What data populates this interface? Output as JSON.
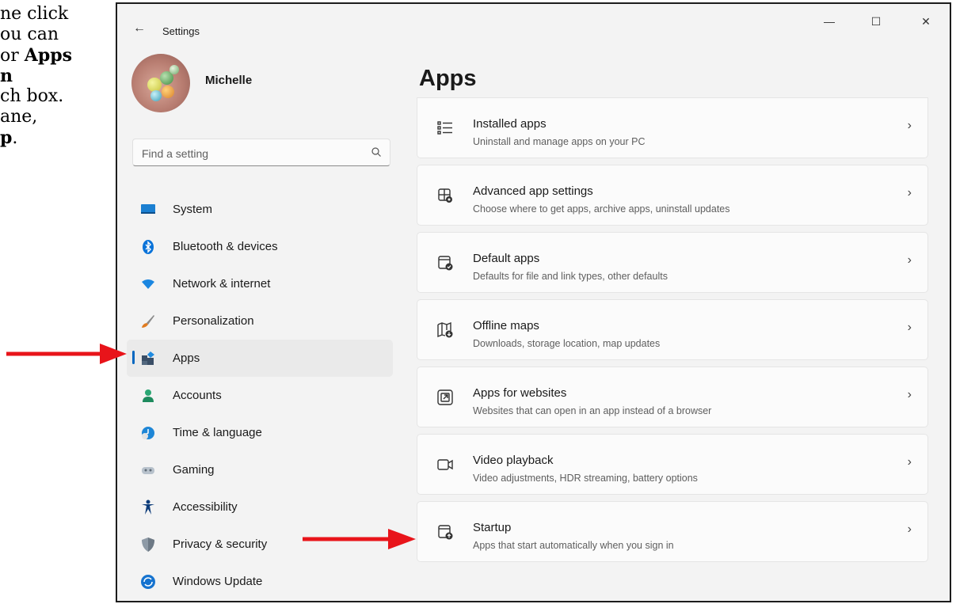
{
  "document": {
    "lines": [
      [
        {
          "t": "ne click",
          "b": false
        }
      ],
      [
        {
          "t": "ou can",
          "b": false
        }
      ],
      [
        {
          "t": "or ",
          "b": false
        },
        {
          "t": "Apps",
          "b": true
        }
      ],
      [
        {
          "t": "n",
          "b": true
        }
      ],
      [
        {
          "t": "ch box.",
          "b": false
        }
      ],
      [
        {
          "t": "ane,",
          "b": false
        }
      ],
      [
        {
          "t": "p",
          "b": true
        },
        {
          "t": ".",
          "b": false
        }
      ]
    ]
  },
  "window": {
    "back_glyph": "←",
    "title": "Settings",
    "controls": {
      "minimize": "—",
      "maximize": "☐",
      "close": "✕"
    }
  },
  "user": {
    "name": "Michelle"
  },
  "search": {
    "placeholder": "Find a setting"
  },
  "sidebar": {
    "items": [
      {
        "label": "System",
        "icon": "system-icon",
        "selected": false
      },
      {
        "label": "Bluetooth & devices",
        "icon": "bluetooth-icon",
        "selected": false
      },
      {
        "label": "Network & internet",
        "icon": "wifi-icon",
        "selected": false
      },
      {
        "label": "Personalization",
        "icon": "brush-icon",
        "selected": false
      },
      {
        "label": "Apps",
        "icon": "apps-icon",
        "selected": true
      },
      {
        "label": "Accounts",
        "icon": "person-icon",
        "selected": false
      },
      {
        "label": "Time & language",
        "icon": "globe-clock-icon",
        "selected": false
      },
      {
        "label": "Gaming",
        "icon": "gamepad-icon",
        "selected": false
      },
      {
        "label": "Accessibility",
        "icon": "accessibility-icon",
        "selected": false
      },
      {
        "label": "Privacy & security",
        "icon": "shield-icon",
        "selected": false
      },
      {
        "label": "Windows Update",
        "icon": "update-icon",
        "selected": false
      }
    ]
  },
  "main": {
    "title": "Apps",
    "cards": [
      {
        "title": "Installed apps",
        "subtitle": "Uninstall and manage apps on your PC",
        "icon": "list-icon"
      },
      {
        "title": "Advanced app settings",
        "subtitle": "Choose where to get apps, archive apps, uninstall updates",
        "icon": "app-settings-icon"
      },
      {
        "title": "Default apps",
        "subtitle": "Defaults for file and link types, other defaults",
        "icon": "default-apps-icon"
      },
      {
        "title": "Offline maps",
        "subtitle": "Downloads, storage location, map updates",
        "icon": "map-icon"
      },
      {
        "title": "Apps for websites",
        "subtitle": "Websites that can open in an app instead of a browser",
        "icon": "open-in-app-icon"
      },
      {
        "title": "Video playback",
        "subtitle": "Video adjustments, HDR streaming, battery options",
        "icon": "video-icon"
      },
      {
        "title": "Startup",
        "subtitle": "Apps that start automatically when you sign in",
        "icon": "startup-icon"
      }
    ],
    "chevron": "›"
  },
  "colors": {
    "accent": "#0067c0",
    "annotation_arrow": "#e8141a"
  }
}
